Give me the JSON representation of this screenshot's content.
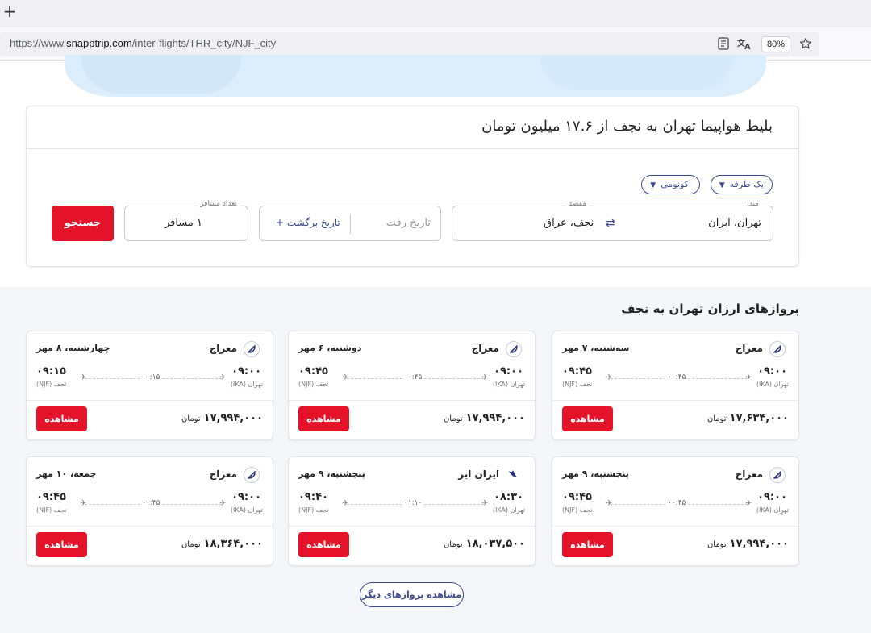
{
  "browser": {
    "new_tab": "+",
    "url_prefix": "https://www.",
    "url_host": "snapptrip.com",
    "url_path": "/inter-flights/THR_city/NJF_city",
    "zoom": "80%"
  },
  "search": {
    "title": "بلیط هواپیما تهران به نجف از ۱۷.۶ میلیون تومان",
    "trip_type": "یک طرفه",
    "cabin_class": "اکونومی",
    "origin_label": "مبدا",
    "origin_value": "تهران، ایران",
    "destination_label": "مقصد",
    "destination_value": "نجف، عراق",
    "depart_placeholder": "تاریخ رفت",
    "return_label": "تاریخ برگشت  +",
    "passengers_label": "تعداد مسافر",
    "passengers_value": "۱ مسافر",
    "search_button": "جستجو"
  },
  "results": {
    "section_title": "پروازهای ارزان تهران به نجف",
    "more_button": "مشاهده پروازهای دیگر",
    "view_label": "مشاهده",
    "currency": "تومان",
    "dep_city": "تهران (IKA)",
    "arr_city": "نجف (NJF)",
    "flights": [
      {
        "airline": "معراج",
        "date": "سه‌شنبه، ۷ مهر",
        "dep_time": "۰۹:۰۰",
        "arr_time": "۰۹:۴۵",
        "duration": "۰۰:۴۵",
        "price": "۱۷,۶۳۴,۰۰۰"
      },
      {
        "airline": "معراج",
        "date": "دوشنبه، ۶ مهر",
        "dep_time": "۰۹:۰۰",
        "arr_time": "۰۹:۴۵",
        "duration": "۰۰:۴۵",
        "price": "۱۷,۹۹۴,۰۰۰"
      },
      {
        "airline": "معراج",
        "date": "چهارشنبه، ۸ مهر",
        "dep_time": "۰۹:۰۰",
        "arr_time": "۰۹:۱۵",
        "duration": "۰۰:۱۵",
        "price": "۱۷,۹۹۴,۰۰۰"
      },
      {
        "airline": "معراج",
        "date": "پنجشنبه، ۹ مهر",
        "dep_time": "۰۹:۰۰",
        "arr_time": "۰۹:۴۵",
        "duration": "۰۰:۴۵",
        "price": "۱۷,۹۹۴,۰۰۰"
      },
      {
        "airline": "ایران ایر",
        "date": "پنجشنبه، ۹ مهر",
        "dep_time": "۰۸:۳۰",
        "arr_time": "۰۹:۴۰",
        "duration": "۰۱:۱۰",
        "price": "۱۸,۰۳۷,۵۰۰"
      },
      {
        "airline": "معراج",
        "date": "جمعه، ۱۰ مهر",
        "dep_time": "۰۹:۰۰",
        "arr_time": "۰۹:۴۵",
        "duration": "۰۰:۴۵",
        "price": "۱۸,۳۶۴,۰۰۰"
      }
    ]
  },
  "colors": {
    "accent_red": "#e5132a",
    "brand_navy": "#3d4a8f"
  }
}
